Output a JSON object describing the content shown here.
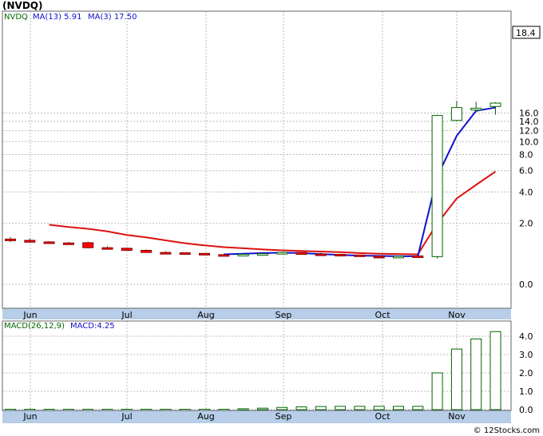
{
  "header": {
    "title": "(NVDQ)",
    "legend_price": "NVDQ",
    "legend_ma13": "MA(13)  5.91",
    "legend_ma3": "MA(3)  17.50",
    "last_price_label": "18.4"
  },
  "macd_legend": {
    "label": "MACD(26,12,9)",
    "value": "MACD:4.25"
  },
  "footer": {
    "credit": "© 12Stocks.com"
  },
  "colors": {
    "up": "#ffffff",
    "down": "#ff0000",
    "wick": "#006600",
    "ma13": "#dd1111",
    "ma3": "#1111cc",
    "grid": "#bbbbbb",
    "axis_band": "#b7cde8",
    "macd_up": "#006600"
  },
  "chart_data": [
    {
      "type": "candlestick",
      "symbol": "NVDQ",
      "x_tick_labels": [
        "Jun",
        "Jul",
        "Aug",
        "Sep",
        "Oct",
        "Nov"
      ],
      "y_tick_labels": [
        "0.0",
        "2.0",
        "4.0",
        "6.0",
        "8.0",
        "10.0",
        "12.0",
        "14.0",
        "16.0"
      ],
      "y_scale": "log",
      "last_price": 18.4,
      "series": [
        {
          "name": "MA(13)",
          "value_label": "5.91"
        },
        {
          "name": "MA(3)",
          "value_label": "17.50"
        }
      ],
      "candles": [
        {
          "o": 1.3,
          "h": 1.38,
          "l": 1.18,
          "c": 1.28
        },
        {
          "o": 1.25,
          "h": 1.32,
          "l": 1.16,
          "c": 1.18
        },
        {
          "o": 1.19,
          "h": 1.22,
          "l": 1.13,
          "c": 1.16
        },
        {
          "o": 1.15,
          "h": 1.19,
          "l": 1.12,
          "c": 1.14
        },
        {
          "o": 1.16,
          "h": 1.2,
          "l": 0.95,
          "c": 0.98
        },
        {
          "o": 0.98,
          "h": 1.03,
          "l": 0.93,
          "c": 0.96
        },
        {
          "o": 0.96,
          "h": 0.99,
          "l": 0.88,
          "c": 0.89
        },
        {
          "o": 0.89,
          "h": 0.92,
          "l": 0.81,
          "c": 0.82
        },
        {
          "o": 0.82,
          "h": 0.86,
          "l": 0.8,
          "c": 0.81
        },
        {
          "o": 0.81,
          "h": 0.82,
          "l": 0.78,
          "c": 0.79
        },
        {
          "o": 0.79,
          "h": 0.8,
          "l": 0.74,
          "c": 0.75
        },
        {
          "o": 0.75,
          "h": 0.76,
          "l": 0.72,
          "c": 0.74
        },
        {
          "o": 0.75,
          "h": 0.79,
          "l": 0.73,
          "c": 0.76
        },
        {
          "o": 0.76,
          "h": 0.79,
          "l": 0.75,
          "c": 0.78
        },
        {
          "o": 0.79,
          "h": 0.83,
          "l": 0.78,
          "c": 0.82
        },
        {
          "o": 0.82,
          "h": 0.84,
          "l": 0.75,
          "c": 0.76
        },
        {
          "o": 0.77,
          "h": 0.81,
          "l": 0.75,
          "c": 0.76
        },
        {
          "o": 0.76,
          "h": 0.78,
          "l": 0.73,
          "c": 0.74
        },
        {
          "o": 0.74,
          "h": 0.75,
          "l": 0.69,
          "c": 0.7
        },
        {
          "o": 0.7,
          "h": 0.71,
          "l": 0.68,
          "c": 0.69
        },
        {
          "o": 0.69,
          "h": 0.71,
          "l": 0.67,
          "c": 0.7
        },
        {
          "o": 0.71,
          "h": 0.72,
          "l": 0.68,
          "c": 0.69
        },
        {
          "o": 0.69,
          "h": 15.6,
          "l": 0.63,
          "c": 15.4
        },
        {
          "o": 14.2,
          "h": 19.5,
          "l": 14.0,
          "c": 17.5
        },
        {
          "o": 16.8,
          "h": 19.2,
          "l": 16.2,
          "c": 17.3
        },
        {
          "o": 17.8,
          "h": 19.1,
          "l": 15.6,
          "c": 18.8
        }
      ],
      "ma13": [
        1.93,
        1.82,
        1.74,
        1.62,
        1.47,
        1.37,
        1.25,
        1.14,
        1.06,
        1.0,
        0.96,
        0.92,
        0.89,
        0.87,
        0.85,
        0.83,
        0.8,
        0.78,
        0.77,
        0.76,
        2.0,
        3.5,
        4.6,
        5.91
      ],
      "ma3": [
        0.76,
        0.78,
        0.8,
        0.81,
        0.8,
        0.77,
        0.74,
        0.72,
        0.71,
        0.7,
        0.7,
        5.4,
        11.0,
        16.6,
        17.5
      ]
    },
    {
      "type": "bar",
      "name": "MACD(26,12,9)",
      "y_tick_labels": [
        "0.0",
        "1.0",
        "2.0",
        "3.0",
        "4.0"
      ],
      "values": [
        0.02,
        0.02,
        0.02,
        0.02,
        0.02,
        0.02,
        0.02,
        0.02,
        0.02,
        0.02,
        0.02,
        0.02,
        0.05,
        0.08,
        0.12,
        0.15,
        0.17,
        0.18,
        0.18,
        0.18,
        0.18,
        0.18,
        2.0,
        3.3,
        3.85,
        4.25
      ]
    }
  ]
}
